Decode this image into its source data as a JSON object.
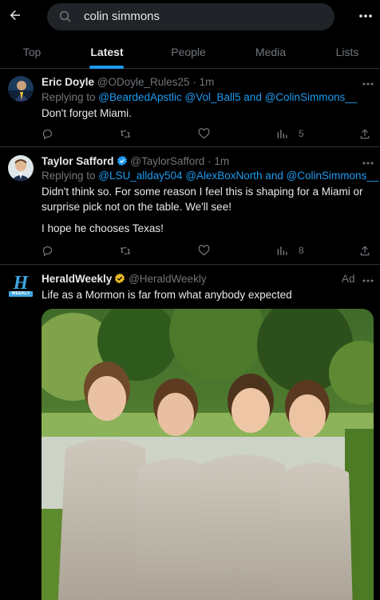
{
  "search": {
    "query": "colin simmons"
  },
  "tabs": [
    {
      "label": "Top"
    },
    {
      "label": "Latest"
    },
    {
      "label": "People"
    },
    {
      "label": "Media"
    },
    {
      "label": "Lists"
    }
  ],
  "tweets": [
    {
      "name": "Eric Doyle",
      "handle": "@ODoyle_Rules25",
      "sep": "·",
      "time": "1m",
      "reply_prefix": "Replying to ",
      "mentions": "@BeardedApstlic @Vol_Ball5 and @ColinSimmons__",
      "text": "Don't forget Miami.",
      "views": "5"
    },
    {
      "name": "Taylor Safford",
      "handle": "@TaylorSafford",
      "sep": "·",
      "time": "1m",
      "reply_prefix": "Replying to ",
      "mentions": "@LSU_allday504 @AlexBoxNorth and @ColinSimmons__",
      "text1": "Didn't think so. For some reason I feel this is shaping for a Miami or surprise pick not on the table. We'll see!",
      "text2": "I hope he chooses Texas!",
      "views": "8"
    },
    {
      "name": "HeraldWeekly",
      "handle": "@HeraldWeekly",
      "ad_label": "Ad",
      "text": "Life as a Mormon is far from what anybody expected",
      "logo_text": "WEEKLY"
    }
  ],
  "colors": {
    "accent": "#1d9bf0",
    "gold_badge": "#e8b923"
  }
}
